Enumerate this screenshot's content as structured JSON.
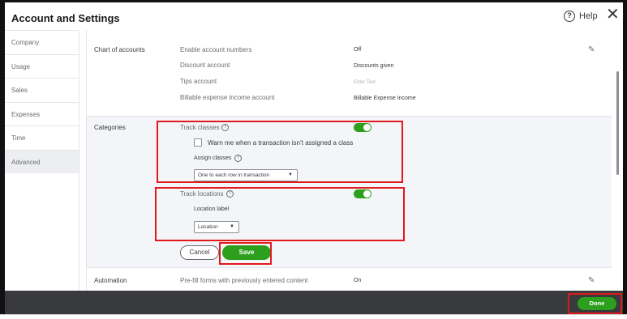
{
  "header": {
    "title": "Account and Settings",
    "help_label": "Help",
    "help_glyph": "?",
    "close_glyph": "✕"
  },
  "sidebar": {
    "items": [
      {
        "label": "Company"
      },
      {
        "label": "Usage"
      },
      {
        "label": "Sales"
      },
      {
        "label": "Expenses"
      },
      {
        "label": "Time"
      },
      {
        "label": "Advanced",
        "active": true
      }
    ]
  },
  "chart_of_accounts": {
    "section_label": "Chart of accounts",
    "rows": [
      {
        "label": "Enable account numbers",
        "value": "Off"
      },
      {
        "label": "Discount account",
        "value": "Discounts given"
      },
      {
        "label": "Tips account",
        "placeholder": "Enter Text"
      },
      {
        "label": "Billable expense income account",
        "value": "Billable Expense Income"
      }
    ]
  },
  "categories": {
    "section_label": "Categories",
    "track_classes": {
      "label": "Track classes",
      "enabled": true,
      "warn_checkbox_label": "Warn me when a transaction isn’t assigned a class",
      "warn_checked": false,
      "assign_label": "Assign classes",
      "assign_value": "One to each row in transaction"
    },
    "track_locations": {
      "label": "Track locations",
      "enabled": true,
      "location_label_title": "Location label",
      "location_label_value": "Location"
    },
    "cancel_label": "Cancel",
    "save_label": "Save"
  },
  "automation": {
    "section_label": "Automation",
    "rows": [
      {
        "label": "Pre-fill forms with previously entered content",
        "value": "On"
      }
    ]
  },
  "footer": {
    "done_label": "Done"
  },
  "colors": {
    "accent_green": "#2ca01c",
    "highlight_red": "#e0191c",
    "footer_dark": "#393a3d"
  }
}
